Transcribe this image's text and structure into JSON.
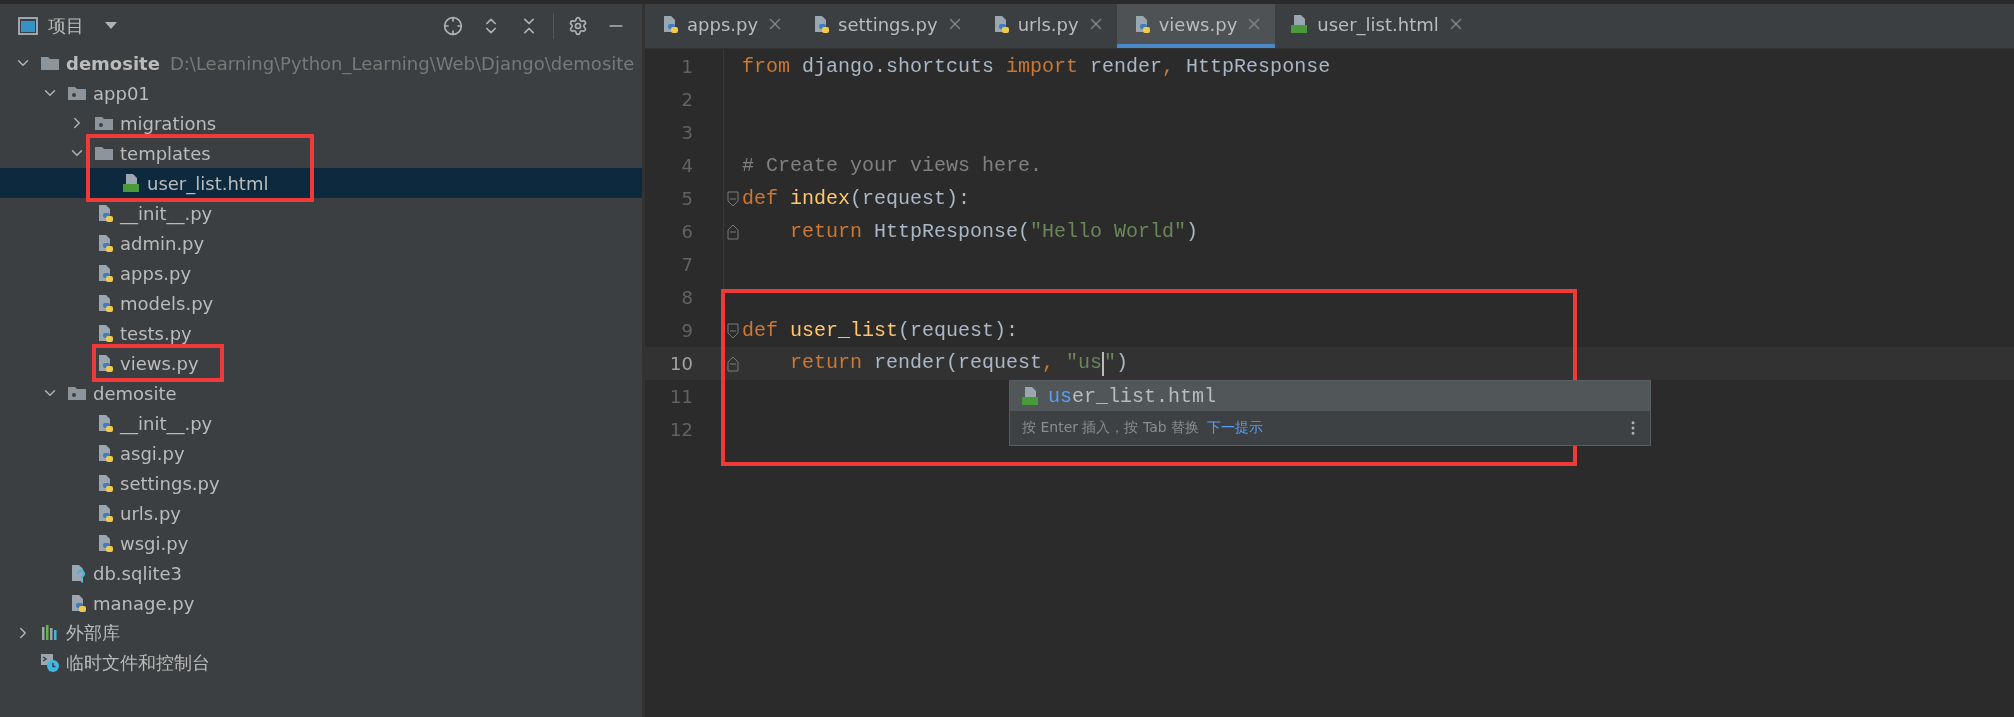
{
  "project_panel": {
    "title": "项目",
    "toolbar": [
      {
        "kind": "locate"
      },
      {
        "kind": "expand-all"
      },
      {
        "kind": "collapse-all"
      },
      {
        "kind": "settings"
      },
      {
        "kind": "hide"
      }
    ],
    "tree": [
      {
        "name": "demosite",
        "kind": "folder",
        "path": "D:\\Learning\\Python_Learning\\Web\\Django\\demosite",
        "expanded": true,
        "selected": false,
        "annotated": false,
        "children": [
          {
            "name": "app01",
            "kind": "module-folder",
            "expanded": true,
            "selected": false,
            "annotated": false,
            "children": [
              {
                "name": "migrations",
                "kind": "module-folder",
                "expanded": false,
                "selected": false,
                "annotated": false
              },
              {
                "name": "templates",
                "kind": "folder",
                "expanded": true,
                "selected": false,
                "annotated": true,
                "children": [
                  {
                    "name": "user_list.html",
                    "kind": "html",
                    "selected": true,
                    "annotated": false
                  }
                ]
              },
              {
                "name": "__init__.py",
                "kind": "python",
                "selected": false,
                "annotated": false
              },
              {
                "name": "admin.py",
                "kind": "python",
                "selected": false,
                "annotated": false
              },
              {
                "name": "apps.py",
                "kind": "python",
                "selected": false,
                "annotated": false
              },
              {
                "name": "models.py",
                "kind": "python",
                "selected": false,
                "annotated": false
              },
              {
                "name": "tests.py",
                "kind": "python",
                "selected": false,
                "annotated": false
              },
              {
                "name": "views.py",
                "kind": "python",
                "selected": false,
                "annotated": true
              }
            ]
          },
          {
            "name": "demosite",
            "kind": "module-folder",
            "expanded": true,
            "selected": false,
            "annotated": false,
            "children": [
              {
                "name": "__init__.py",
                "kind": "python",
                "selected": false,
                "annotated": false
              },
              {
                "name": "asgi.py",
                "kind": "python",
                "selected": false,
                "annotated": false
              },
              {
                "name": "settings.py",
                "kind": "python",
                "selected": false,
                "annotated": false
              },
              {
                "name": "urls.py",
                "kind": "python",
                "selected": false,
                "annotated": false
              },
              {
                "name": "wsgi.py",
                "kind": "python",
                "selected": false,
                "annotated": false
              }
            ]
          },
          {
            "name": "db.sqlite3",
            "kind": "unknown",
            "selected": false,
            "annotated": false
          },
          {
            "name": "manage.py",
            "kind": "python",
            "selected": false,
            "annotated": false
          }
        ]
      },
      {
        "name": "外部库",
        "kind": "library",
        "expanded": false,
        "selected": false,
        "annotated": false
      },
      {
        "name": "临时文件和控制台",
        "kind": "scratch",
        "selected": false,
        "annotated": false
      }
    ]
  },
  "editor": {
    "tabs": [
      {
        "label": "apps.py",
        "kind": "python",
        "selected": false
      },
      {
        "label": "settings.py",
        "kind": "python",
        "selected": false
      },
      {
        "label": "urls.py",
        "kind": "python",
        "selected": false
      },
      {
        "label": "views.py",
        "kind": "python",
        "selected": true
      },
      {
        "label": "user_list.html",
        "kind": "html",
        "selected": false
      }
    ],
    "lines": [
      {
        "number": "1",
        "current": false,
        "annotated": false,
        "tokens": [
          {
            "text": "from ",
            "kind": "keyword"
          },
          {
            "text": "django.shortcuts ",
            "kind": "plain"
          },
          {
            "text": "import ",
            "kind": "keyword"
          },
          {
            "text": "render",
            "kind": "plain"
          },
          {
            "text": ", ",
            "kind": "keyword"
          },
          {
            "text": "HttpResponse",
            "kind": "plain"
          }
        ]
      },
      {
        "number": "2",
        "current": false,
        "annotated": false
      },
      {
        "number": "3",
        "current": false,
        "annotated": false
      },
      {
        "number": "4",
        "current": false,
        "annotated": false,
        "tokens": [
          {
            "text": "# Create your views here.",
            "kind": "comment"
          }
        ]
      },
      {
        "number": "5",
        "current": false,
        "annotated": false,
        "fold_start": true,
        "tokens": [
          {
            "text": "def ",
            "kind": "keyword"
          },
          {
            "text": "index",
            "kind": "function"
          },
          {
            "text": "(request):",
            "kind": "plain"
          }
        ]
      },
      {
        "number": "6",
        "current": false,
        "annotated": false,
        "fold_end": true,
        "tokens": [
          {
            "text": "    return ",
            "kind": "keyword"
          },
          {
            "text": "HttpResponse(",
            "kind": "plain"
          },
          {
            "text": "\"Hello World\"",
            "kind": "string"
          },
          {
            "text": ")",
            "kind": "plain"
          }
        ]
      },
      {
        "number": "7",
        "current": false,
        "annotated": false
      },
      {
        "number": "8",
        "current": false,
        "annotated": true
      },
      {
        "number": "9",
        "current": false,
        "annotated": true,
        "fold_start": true,
        "tokens": [
          {
            "text": "def ",
            "kind": "keyword"
          },
          {
            "text": "user_list",
            "kind": "function"
          },
          {
            "text": "(request):",
            "kind": "plain"
          }
        ]
      },
      {
        "number": "10",
        "current": true,
        "annotated": true,
        "fold_end": true,
        "tokens": [
          {
            "text": "    return ",
            "kind": "keyword"
          },
          {
            "text": "render(request",
            "kind": "plain"
          },
          {
            "text": ", ",
            "kind": "keyword"
          },
          {
            "text": "\"us",
            "kind": "string",
            "caret": true
          },
          {
            "text": "\"",
            "kind": "string"
          },
          {
            "text": ")",
            "kind": "plain"
          }
        ]
      },
      {
        "number": "11",
        "current": false,
        "annotated": true
      },
      {
        "number": "12",
        "current": false,
        "annotated": true
      }
    ],
    "completion": {
      "items": [
        {
          "match": "us",
          "rest": "er_list.html",
          "kind": "html",
          "selected": true
        }
      ],
      "hint": "按 Enter 插入，按 Tab 替换",
      "hint_link": "下一提示"
    }
  }
}
